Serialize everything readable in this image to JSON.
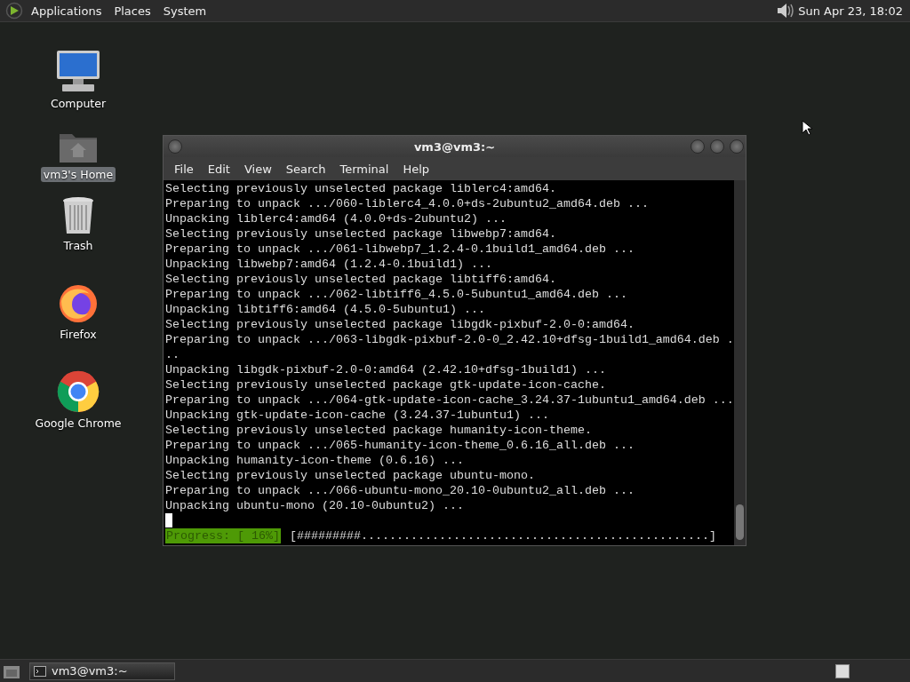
{
  "top_panel": {
    "menus": [
      "Applications",
      "Places",
      "System"
    ],
    "clock": "Sun Apr 23, 18:02"
  },
  "desktop_icons": [
    {
      "label": "Computer",
      "kind": "computer",
      "selected": false
    },
    {
      "label": "vm3's Home",
      "kind": "home",
      "selected": true
    },
    {
      "label": "Trash",
      "kind": "trash",
      "selected": false
    },
    {
      "label": "Firefox",
      "kind": "firefox",
      "selected": false
    },
    {
      "label": "Google Chrome",
      "kind": "chrome",
      "selected": false
    }
  ],
  "terminal": {
    "title": "vm3@vm3:~",
    "menu": [
      "File",
      "Edit",
      "View",
      "Search",
      "Terminal",
      "Help"
    ],
    "lines": [
      "Selecting previously unselected package liblerc4:amd64.",
      "Preparing to unpack .../060-liblerc4_4.0.0+ds-2ubuntu2_amd64.deb ...",
      "Unpacking liblerc4:amd64 (4.0.0+ds-2ubuntu2) ...",
      "Selecting previously unselected package libwebp7:amd64.",
      "Preparing to unpack .../061-libwebp7_1.2.4-0.1build1_amd64.deb ...",
      "Unpacking libwebp7:amd64 (1.2.4-0.1build1) ...",
      "Selecting previously unselected package libtiff6:amd64.",
      "Preparing to unpack .../062-libtiff6_4.5.0-5ubuntu1_amd64.deb ...",
      "Unpacking libtiff6:amd64 (4.5.0-5ubuntu1) ...",
      "Selecting previously unselected package libgdk-pixbuf-2.0-0:amd64.",
      "Preparing to unpack .../063-libgdk-pixbuf-2.0-0_2.42.10+dfsg-1build1_amd64.deb ...",
      "Unpacking libgdk-pixbuf-2.0-0:amd64 (2.42.10+dfsg-1build1) ...",
      "Selecting previously unselected package gtk-update-icon-cache.",
      "Preparing to unpack .../064-gtk-update-icon-cache_3.24.37-1ubuntu1_amd64.deb ...",
      "Unpacking gtk-update-icon-cache (3.24.37-1ubuntu1) ...",
      "Selecting previously unselected package humanity-icon-theme.",
      "Preparing to unpack .../065-humanity-icon-theme_0.6.16_all.deb ...",
      "Unpacking humanity-icon-theme (0.6.16) ...",
      "Selecting previously unselected package ubuntu-mono.",
      "Preparing to unpack .../066-ubuntu-mono_20.10-0ubuntu2_all.deb ...",
      "Unpacking ubuntu-mono (20.10-0ubuntu2) ..."
    ],
    "progress": {
      "label": "Progress: [ 16%]",
      "bar": "[#########.................................................]"
    }
  },
  "taskbar": {
    "tasks": [
      {
        "label": "vm3@vm3:~",
        "selected": false
      }
    ]
  }
}
